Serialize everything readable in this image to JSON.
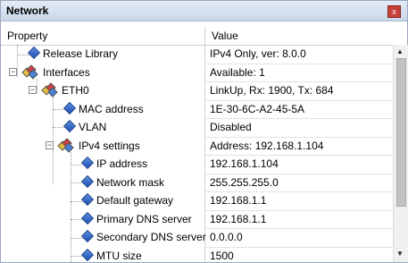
{
  "window": {
    "title": "Network",
    "close_glyph": "x"
  },
  "columns": {
    "property": "Property",
    "value": "Value"
  },
  "rows": [
    {
      "label": "Release Library",
      "value": "IPv4 Only, ver: 8.0.0"
    },
    {
      "label": "Interfaces",
      "value": "Available: 1"
    },
    {
      "label": "ETH0",
      "value": "LinkUp, Rx: 1900, Tx: 684"
    },
    {
      "label": "MAC address",
      "value": "1E-30-6C-A2-45-5A"
    },
    {
      "label": "VLAN",
      "value": "Disabled"
    },
    {
      "label": "IPv4 settings",
      "value": "Address: 192.168.1.104"
    },
    {
      "label": "IP address",
      "value": "192.168.1.104"
    },
    {
      "label": "Network mask",
      "value": "255.255.255.0"
    },
    {
      "label": "Default gateway",
      "value": "192.168.1.1"
    },
    {
      "label": "Primary DNS server",
      "value": "192.168.1.1"
    },
    {
      "label": "Secondary DNS server",
      "value": "0.0.0.0"
    },
    {
      "label": "MTU size",
      "value": "1500"
    }
  ],
  "icons": {
    "leaf": "property-diamond-icon",
    "group": "property-group-icon",
    "expanded": "minus-box-icon",
    "scroll_up": "arrow-up-icon",
    "scroll_down": "arrow-down-icon"
  },
  "colors": {
    "titlebar": "#c9d7ea",
    "close": "#c8403a",
    "diamond": "#1d4fb3"
  }
}
